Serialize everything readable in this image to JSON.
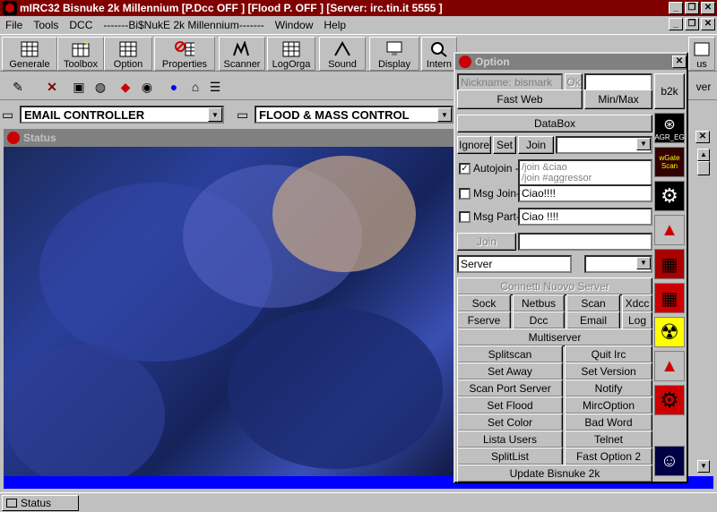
{
  "window": {
    "title": "mIRC32 Bisnuke 2k Millennium [P.Dcc OFF ] [Flood P. OFF ] [Server: irc.tin.it 5555 ]"
  },
  "menu": [
    "File",
    "Tools",
    "DCC",
    "-------Bi$NukE 2k Millennium-------",
    "Window",
    "Help"
  ],
  "toolbar": {
    "buttons": [
      "Generale",
      "Toolbox",
      "Option",
      "Properties",
      "Scanner",
      "LogOrga",
      "Sound",
      "Display",
      "Intern"
    ],
    "partial_right": "us",
    "partial_right2": "ver"
  },
  "combos": {
    "left": "EMAIL CONTROLLER",
    "right": "FLOOD & MASS CONTROL"
  },
  "status_window": {
    "title": "Status"
  },
  "taskbar": {
    "status_label": "Status"
  },
  "option": {
    "title": "Option",
    "nickname_placeholder": "Nickname: bismark",
    "ok_label": "Ok",
    "fastweb_label": "Fast Web",
    "minmax_label": "Min/Max",
    "b2k_label": "b2k",
    "databox_label": "DataBox",
    "ignore_label": "Ignore",
    "set_label": "Set",
    "join_label": "Join",
    "autojoin_label": "Autojoin -[",
    "autojoin_lines": [
      "/join &ciao",
      "/join #aggressor"
    ],
    "msgjoin_label": "Msg Join-[",
    "msgjoin_value": "Ciao!!!!",
    "msgpart_label": "Msg Part-[",
    "msgpart_value": "Ciao !!!!",
    "join2_label": "Join",
    "server_value": "Server",
    "connect_label": "Connetti Nuovo Server",
    "row1": [
      "Sock",
      "Netbus",
      "Scan",
      "Xdcc"
    ],
    "row2": [
      "Fserve",
      "Dcc",
      "Email",
      "Log"
    ],
    "multiserver_label": "Multiserver",
    "grid_left": [
      "Splitscan",
      "Set Away",
      "Scan Port Server",
      "Set Flood",
      "Set Color",
      "Lista Users",
      "SplitList"
    ],
    "grid_right": [
      "Quit Irc",
      "Set Version",
      "Notify",
      "MircOption",
      "Bad Word",
      "Telnet",
      "Fast Option 2"
    ],
    "update_label": "Update Bisnuke 2k",
    "agr_label": "AGR_EG",
    "gate_label": "wGate Scan"
  },
  "colors": {
    "title_active": "#800000",
    "title_inactive": "#808080",
    "blue_bar": "#0000ff"
  }
}
